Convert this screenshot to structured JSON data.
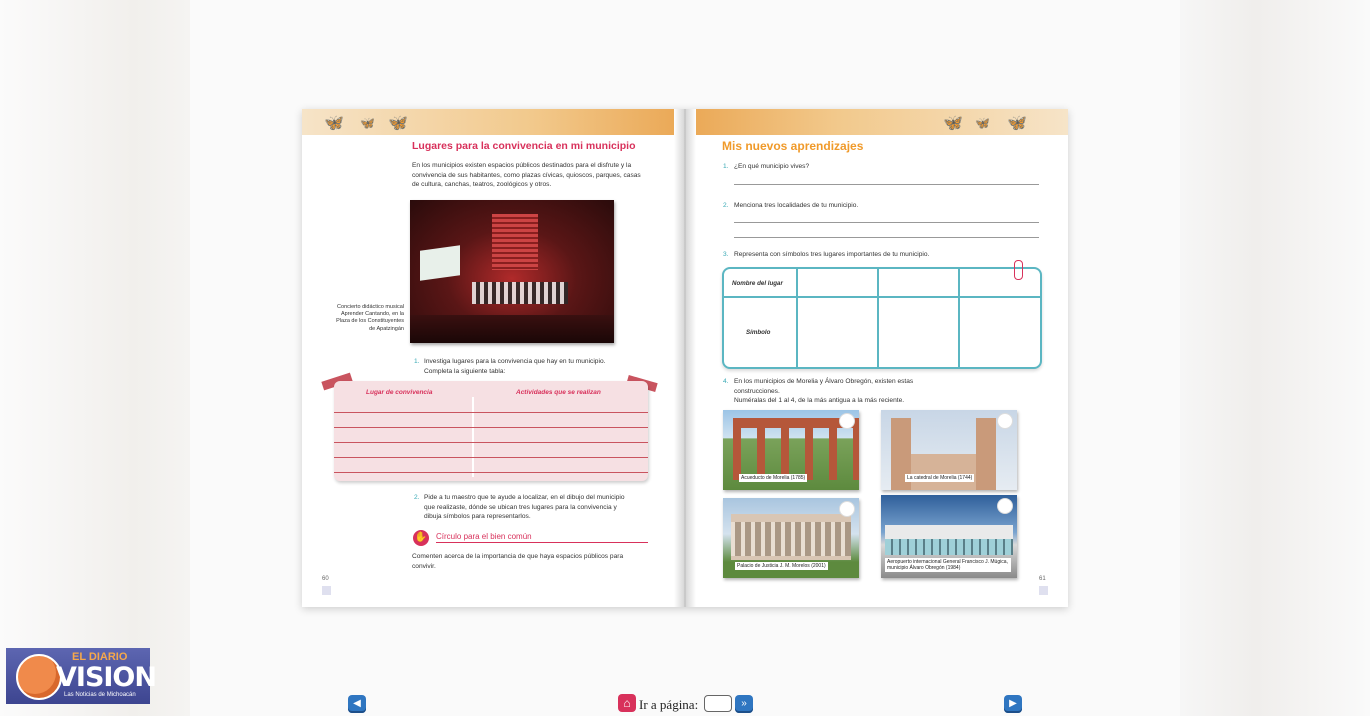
{
  "left_page": {
    "title": "Lugares para la convivencia en mi municipio",
    "intro": "En los municipios existen espacios públicos destinados para el disfrute y la convivencia de sus habitantes, como plazas cívicas, quioscos, parques, casas de cultura, canchas, teatros, zoológicos y otros.",
    "photo_caption": "Concierto didáctico musical Aprender Cantando, en la Plaza de los Constituyentes de Apatzingán",
    "item1_num": "1.",
    "item1": "Investiga lugares para la convivencia que hay en tu municipio. Completa la siguiente tabla:",
    "table_headers": [
      "Lugar de convivencia",
      "Actividades que se realizan"
    ],
    "item2_num": "2.",
    "item2": "Pide a tu maestro que te ayude a localizar, en el dibujo del municipio que realizaste, dónde se ubican tres lugares para la convivencia y dibuja símbolos para representarlos.",
    "circle_title": "Círculo para el bien común",
    "circle_text": "Comenten acerca de la importancia de que haya espacios públicos para convivir.",
    "page_number": "60"
  },
  "right_page": {
    "title": "Mis nuevos aprendizajes",
    "q1_num": "1.",
    "q1": "¿En qué municipio vives?",
    "q2_num": "2.",
    "q2": "Menciona tres localidades de tu municipio.",
    "q3_num": "3.",
    "q3": "Representa con símbolos tres lugares importantes de tu municipio.",
    "table_row1": "Nombre del lugar",
    "table_row2": "Símbolo",
    "q4_num": "4.",
    "q4": "En los municipios de Morelia y Álvaro Obregón, existen estas construcciones.",
    "q4_instruction": "Numéralas del 1 al 4, de la más antigua a la más reciente.",
    "photos": [
      "Acueducto de Morelia (1785)",
      "La catedral de Morelia (1744)",
      "Palacio de Justicia J. M. Morelos (2001)",
      "Aeropuerto internacional General Francisco J. Múgica, municipio Álvaro Obregón (1984)"
    ],
    "page_number": "61"
  },
  "logo": {
    "line1": "EL DIARIO",
    "line2": "VISION",
    "line3": "Las Noticias de Michoacán"
  },
  "nav": {
    "goto_label": "Ir a página:",
    "goto_value": "",
    "prev_icon": "prev-page-icon",
    "next_icon": "next-page-icon",
    "home_icon": "home-icon",
    "go_icon": "fast-forward-icon"
  }
}
